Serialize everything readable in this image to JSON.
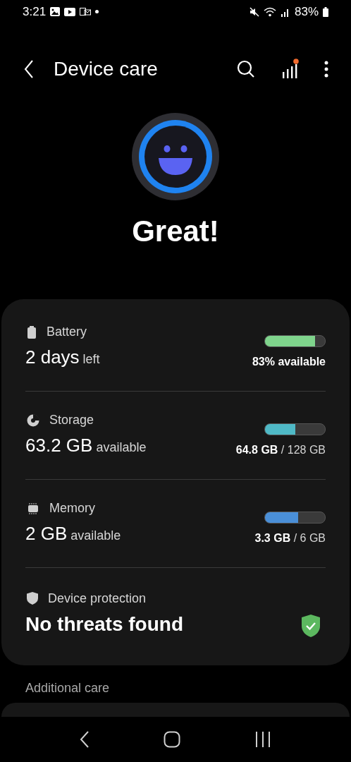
{
  "status_bar": {
    "time": "3:21",
    "battery": "83%"
  },
  "header": {
    "title": "Device care",
    "notification_dot": true
  },
  "status": {
    "headline": "Great!"
  },
  "items": [
    {
      "kind": "meter",
      "label": "Battery",
      "value": "2 days",
      "unit": "left",
      "level": 0.84,
      "color": "#7fd48c",
      "reading": "**83% available**"
    },
    {
      "kind": "meter",
      "label": "Storage",
      "value": "63.2 GB",
      "unit": "available",
      "level": 0.5,
      "color": "#4fb9c6",
      "reading": "**64.8 GB** / 128 GB"
    },
    {
      "kind": "meter",
      "label": "Memory",
      "value": "2 GB",
      "unit": "available",
      "level": 0.55,
      "color": "#4a8fd8",
      "reading": "**3.3 GB** / 6 GB"
    },
    {
      "kind": "protection",
      "label": "Device protection",
      "value": "No threats found",
      "safe": true
    }
  ],
  "section_title": "Additional care"
}
